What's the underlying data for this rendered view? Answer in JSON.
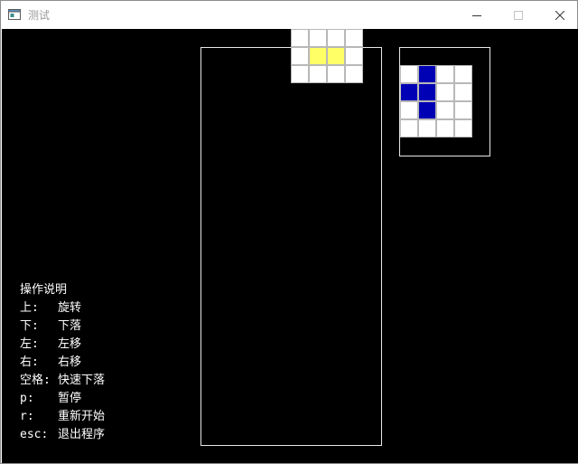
{
  "window": {
    "title": "测试",
    "icon": "window-app-icon",
    "controls": [
      "minimize-icon",
      "maximize-icon",
      "close-icon"
    ]
  },
  "game": {
    "colors": {
      "background": "#000000",
      "border": "#e8e8e8",
      "empty_cell": "#ffffff",
      "grid_line": "#b8b8b8",
      "current_piece": "#ffff66",
      "next_piece": "#0000b4"
    },
    "current_piece": {
      "grid": [
        [
          0,
          0,
          0,
          0
        ],
        [
          0,
          1,
          1,
          0
        ],
        [
          0,
          0,
          0,
          0
        ]
      ]
    },
    "next_piece": {
      "grid": [
        [
          0,
          1,
          0,
          0
        ],
        [
          1,
          1,
          0,
          0
        ],
        [
          0,
          1,
          0,
          0
        ],
        [
          0,
          0,
          0,
          0
        ]
      ]
    }
  },
  "instructions": {
    "title": "操作说明",
    "items": [
      {
        "key": "上:",
        "action": "旋转"
      },
      {
        "key": "下:",
        "action": "下落"
      },
      {
        "key": "左:",
        "action": "左移"
      },
      {
        "key": "右:",
        "action": "右移"
      },
      {
        "key": "空格:",
        "action": "快速下落"
      },
      {
        "key": "p:",
        "action": "暂停"
      },
      {
        "key": "r:",
        "action": "重新开始"
      },
      {
        "key": "esc:",
        "action": "退出程序"
      }
    ]
  }
}
